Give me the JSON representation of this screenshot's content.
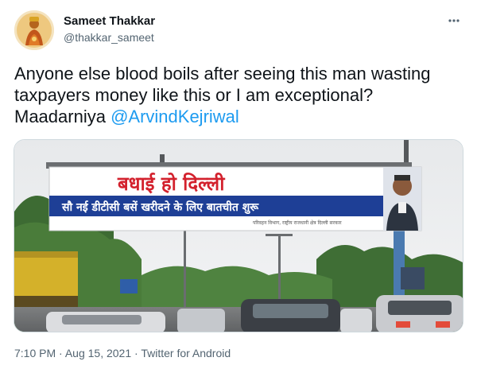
{
  "author": {
    "name": "Sameet Thakkar",
    "handle": "@thakkar_sameet"
  },
  "tweet": {
    "text": "Anyone else blood boils after seeing this man wasting taxpayers money like this or I am exceptional? Maadarniya ",
    "mention": "@ArvindKejriwal"
  },
  "media": {
    "banner_line1": "बधाई हो दिल्ली",
    "banner_line2": "सौ नई डीटीसी बसें खरीदने के लिए बातचीत शुरू",
    "banner_footer": "परिवहन विभाग, राष्ट्रीय राजधानी क्षेत्र दिल्ली सरकार"
  },
  "meta": {
    "time": "7:10 PM",
    "date": "Aug 15, 2021",
    "source": "Twitter for Android",
    "separator": "·"
  },
  "icons": {
    "more": "more-options-icon",
    "avatar": "avatar"
  },
  "colors": {
    "link": "#1d9bf0",
    "secondary_text": "#536471",
    "primary_text": "#0f1419",
    "banner_red": "#d3212d",
    "banner_blue": "#1e3f96"
  }
}
